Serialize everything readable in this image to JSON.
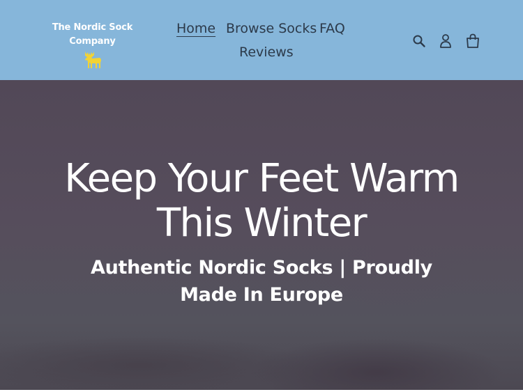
{
  "brand": {
    "name": "The Nordic Sock Company",
    "logo_icon": "moose-icon",
    "logo_color": "#f2d335"
  },
  "nav": {
    "items": [
      {
        "label": "Home",
        "active": true
      },
      {
        "label": "Browse Socks",
        "active": false
      },
      {
        "label": "FAQ",
        "active": false
      },
      {
        "label": "Reviews",
        "active": false
      }
    ]
  },
  "header_icons": [
    "search-icon",
    "account-icon",
    "cart-icon"
  ],
  "hero": {
    "title": "Keep Your Feet Warm This Winter",
    "subtitle": "Authentic Nordic Socks | Proudly Made In Europe"
  },
  "colors": {
    "header_background": "#86b6da",
    "nav_text": "#2c3a4a",
    "hero_overlay": "#524857",
    "hero_text": "#ffffff"
  }
}
